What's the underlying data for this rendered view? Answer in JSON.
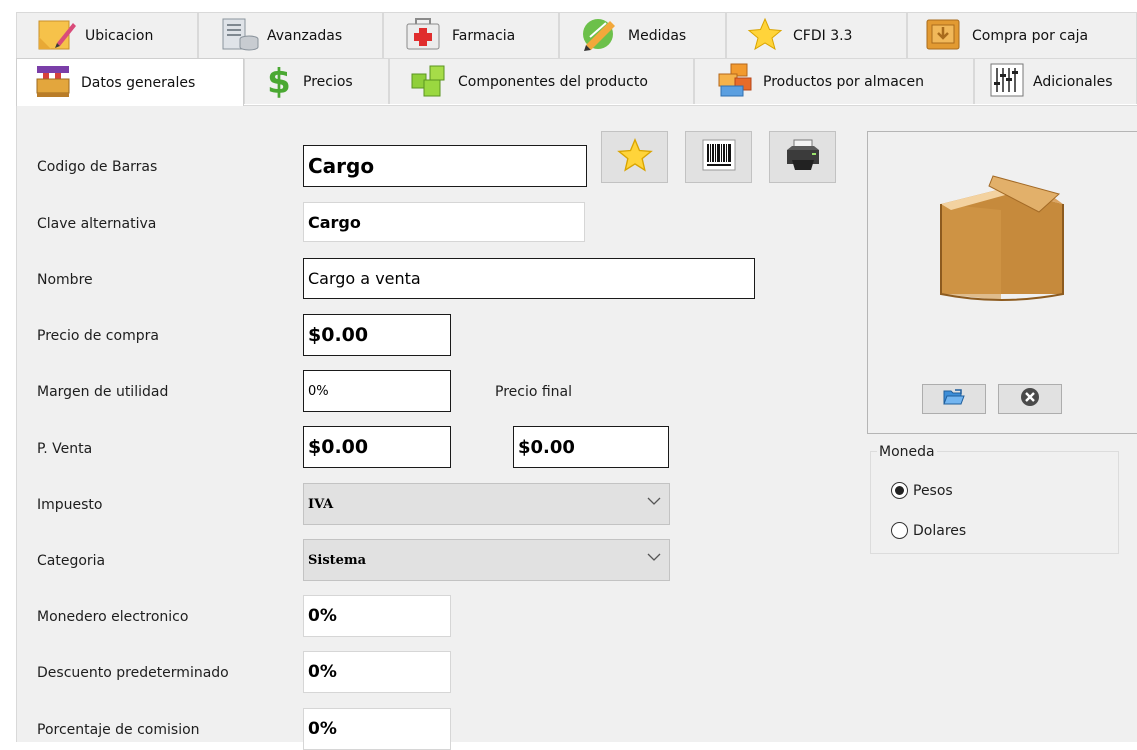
{
  "tabs": {
    "row_back": [
      {
        "label": "Ubicacion",
        "icon": "sticky-note-pencil-icon"
      },
      {
        "label": "Avanzadas",
        "icon": "server-database-icon"
      },
      {
        "label": "Farmacia",
        "icon": "first-aid-kit-icon"
      },
      {
        "label": "Medidas",
        "icon": "ruler-pencil-icon"
      },
      {
        "label": "CFDI 3.3",
        "icon": "star-icon"
      },
      {
        "label": "Compra por caja",
        "icon": "download-box-icon"
      }
    ],
    "row_front": [
      {
        "label": "Datos generales",
        "icon": "storefront-icon",
        "active": true
      },
      {
        "label": "Precios",
        "icon": "dollar-icon"
      },
      {
        "label": "Componentes del producto",
        "icon": "cubes-icon"
      },
      {
        "label": "Productos por almacen",
        "icon": "colored-blocks-icon"
      },
      {
        "label": "Adicionales",
        "icon": "equalizer-sliders-icon"
      }
    ]
  },
  "form": {
    "codigo_barras": {
      "label": "Codigo de Barras",
      "value": "Cargo"
    },
    "clave_alternativa": {
      "label": "Clave alternativa",
      "value": "Cargo"
    },
    "nombre": {
      "label": "Nombre",
      "value": "Cargo a venta"
    },
    "precio_compra": {
      "label": "Precio de compra",
      "value": "$0.00"
    },
    "margen_utilidad": {
      "label": "Margen de utilidad",
      "value": "0%"
    },
    "precio_final": {
      "label": "Precio final",
      "value": "$0.00"
    },
    "p_venta": {
      "label": "P. Venta",
      "value": "$0.00"
    },
    "impuesto": {
      "label": "Impuesto",
      "value": "IVA"
    },
    "categoria": {
      "label": "Categoria",
      "value": "Sistema"
    },
    "monedero": {
      "label": "Monedero electronico",
      "value": "0%"
    },
    "descuento": {
      "label": "Descuento predeterminado",
      "value": "0%"
    },
    "comision": {
      "label": "Porcentaje de comision",
      "value": "0%"
    }
  },
  "toolbar_icons": [
    "star-icon",
    "barcode-icon",
    "printer-icon"
  ],
  "image_panel": {
    "image_icon": "cardboard-box-icon",
    "buttons": [
      "open-folder-icon",
      "remove-circle-icon"
    ]
  },
  "moneda": {
    "legend": "Moneda",
    "options": [
      {
        "label": "Pesos",
        "selected": true
      },
      {
        "label": "Dolares",
        "selected": false
      }
    ]
  },
  "colors": {
    "panel_bg": "#f0f0f0",
    "button_bg": "#e1e1e1",
    "box_brown": "#c98a3c"
  }
}
